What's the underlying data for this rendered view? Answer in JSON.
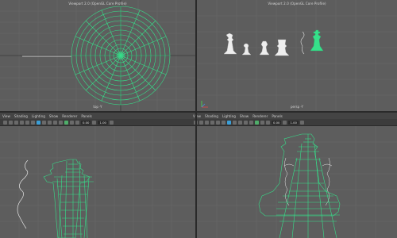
{
  "viewports": {
    "top_left": {
      "title": "Viewport 2.0 (OpenGL Core Profile)",
      "camera": "top -Y"
    },
    "top_right": {
      "title": "Viewport 2.0 (OpenGL Core Profile)",
      "camera": "persp -Y"
    },
    "bottom_left": {
      "menus": [
        "View",
        "Shading",
        "Lighting",
        "Show",
        "Renderer",
        "Panels"
      ],
      "near_clip": "0.00",
      "scale": "1.00"
    },
    "bottom_right": {
      "menus": [
        "View",
        "Shading",
        "Lighting",
        "Show",
        "Renderer",
        "Panels"
      ],
      "near_clip": "0.00",
      "scale": "1.00"
    }
  },
  "colors": {
    "selection_green": "#36e08a",
    "wire_white": "#e6e6e6",
    "viewport_bg": "#5d5d5d"
  }
}
